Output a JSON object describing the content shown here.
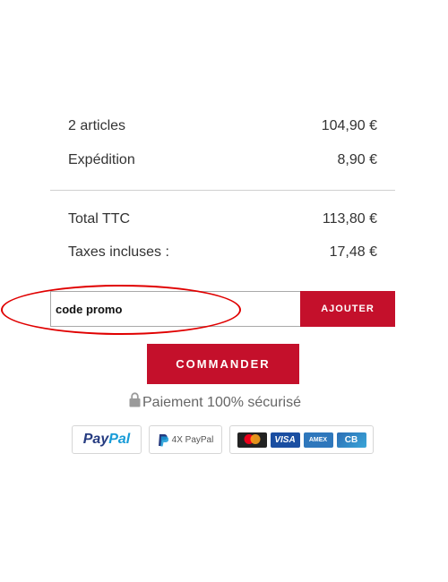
{
  "summary": {
    "articles_label": "2 articles",
    "articles_value": "104,90 €",
    "shipping_label": "Expédition",
    "shipping_value": "8,90 €",
    "total_label": "Total TTC",
    "total_value": "113,80 €",
    "tax_label": "Taxes incluses :",
    "tax_value": "17,48 €"
  },
  "promo": {
    "value": "code promo",
    "button_label": "AJOUTER"
  },
  "checkout": {
    "button_label": "COMMANDER",
    "secure_text": "Paiement 100% sécurisé"
  },
  "payment_badges": {
    "paypal_part1": "Pay",
    "paypal_part2": "Pal",
    "paypal_4x": "4X PayPal",
    "visa": "VISA",
    "amex": "AMEX",
    "cb": "CB"
  },
  "colors": {
    "accent": "#c4102b",
    "annotation": "#e00000",
    "text": "#333333",
    "muted": "#666666"
  },
  "icons": [
    "lock-icon",
    "paypal-p-icon",
    "mastercard-icon"
  ]
}
